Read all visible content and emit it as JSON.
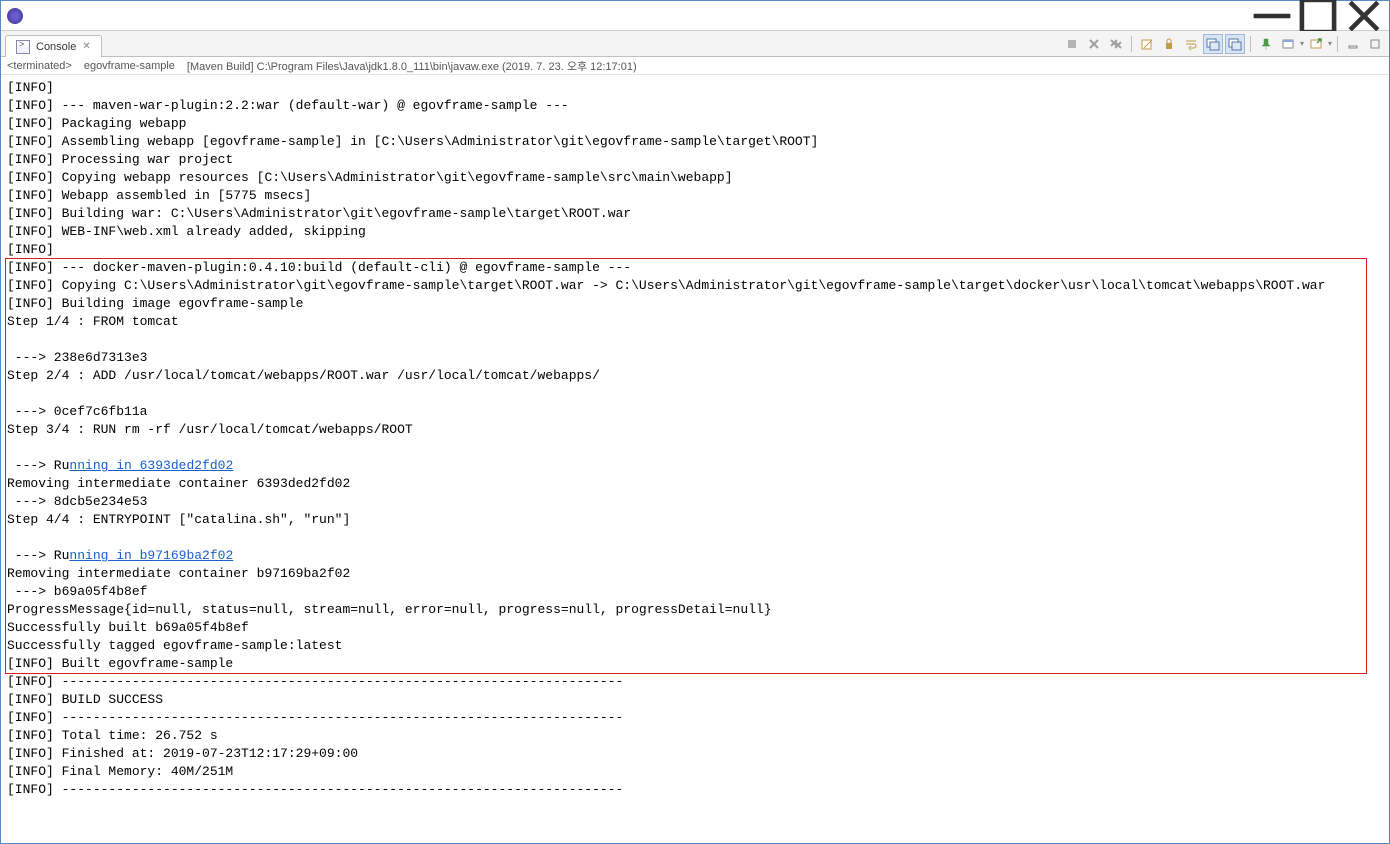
{
  "window": {
    "title": ""
  },
  "tab": {
    "label": "Console"
  },
  "status": {
    "state": "<terminated>",
    "project": "egovframe-sample",
    "config": "[Maven Build] C:\\Program Files\\Java\\jdk1.8.0_111\\bin\\javaw.exe (2019. 7. 23. 오후 12:17:01)"
  },
  "log": {
    "lines": [
      {
        "t": "[INFO]"
      },
      {
        "t": "[INFO] --- maven-war-plugin:2.2:war (default-war) @ egovframe-sample ---"
      },
      {
        "t": "[INFO] Packaging webapp"
      },
      {
        "t": "[INFO] Assembling webapp [egovframe-sample] in [C:\\Users\\Administrator\\git\\egovframe-sample\\target\\ROOT]"
      },
      {
        "t": "[INFO] Processing war project"
      },
      {
        "t": "[INFO] Copying webapp resources [C:\\Users\\Administrator\\git\\egovframe-sample\\src\\main\\webapp]"
      },
      {
        "t": "[INFO] Webapp assembled in [5775 msecs]"
      },
      {
        "t": "[INFO] Building war: C:\\Users\\Administrator\\git\\egovframe-sample\\target\\ROOT.war"
      },
      {
        "t": "[INFO] WEB-INF\\web.xml already added, skipping"
      },
      {
        "t": "[INFO]"
      },
      {
        "t": "[INFO] --- docker-maven-plugin:0.4.10:build (default-cli) @ egovframe-sample ---"
      },
      {
        "t": "[INFO] Copying C:\\Users\\Administrator\\git\\egovframe-sample\\target\\ROOT.war -> C:\\Users\\Administrator\\git\\egovframe-sample\\target\\docker\\usr\\local\\tomcat\\webapps\\ROOT.war"
      },
      {
        "t": "[INFO] Building image egovframe-sample"
      },
      {
        "t": "Step 1/4 : FROM tomcat"
      },
      {
        "t": ""
      },
      {
        "t": " ---> 238e6d7313e3"
      },
      {
        "t": "Step 2/4 : ADD /usr/local/tomcat/webapps/ROOT.war /usr/local/tomcat/webapps/"
      },
      {
        "t": ""
      },
      {
        "t": " ---> 0cef7c6fb11a"
      },
      {
        "t": "Step 3/4 : RUN rm -rf /usr/local/tomcat/webapps/ROOT"
      },
      {
        "t": ""
      },
      {
        "pre": " ---> Ru",
        "link": "nning in 6393ded2fd02"
      },
      {
        "t": "Removing intermediate container 6393ded2fd02"
      },
      {
        "t": " ---> 8dcb5e234e53"
      },
      {
        "t": "Step 4/4 : ENTRYPOINT [\"catalina.sh\", \"run\"]"
      },
      {
        "t": ""
      },
      {
        "pre": " ---> Ru",
        "link": "nning in b97169ba2f02"
      },
      {
        "t": "Removing intermediate container b97169ba2f02"
      },
      {
        "t": " ---> b69a05f4b8ef"
      },
      {
        "t": "ProgressMessage{id=null, status=null, stream=null, error=null, progress=null, progressDetail=null}"
      },
      {
        "t": "Successfully built b69a05f4b8ef"
      },
      {
        "t": "Successfully tagged egovframe-sample:latest"
      },
      {
        "t": "[INFO] Built egovframe-sample"
      },
      {
        "t": "[INFO] ------------------------------------------------------------------------"
      },
      {
        "t": "[INFO] BUILD SUCCESS"
      },
      {
        "t": "[INFO] ------------------------------------------------------------------------"
      },
      {
        "t": "[INFO] Total time: 26.752 s"
      },
      {
        "t": "[INFO] Finished at: 2019-07-23T12:17:29+09:00"
      },
      {
        "t": "[INFO] Final Memory: 40M/251M"
      },
      {
        "t": "[INFO] ------------------------------------------------------------------------"
      }
    ]
  },
  "highlight": {
    "startLine": 10,
    "endLine": 32
  }
}
